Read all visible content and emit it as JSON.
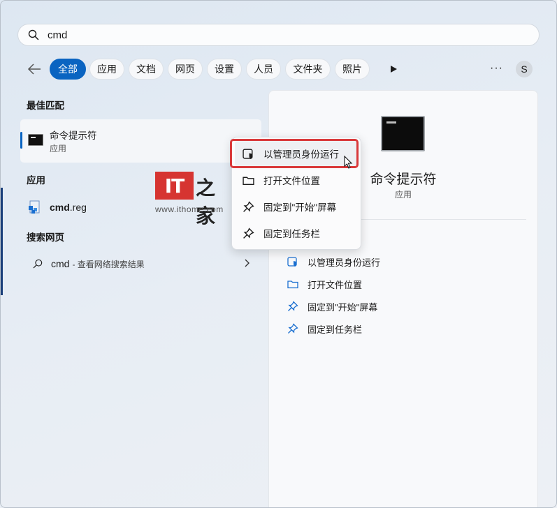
{
  "search": {
    "query": "cmd"
  },
  "filters": {
    "chips": [
      "全部",
      "应用",
      "文档",
      "网页",
      "设置",
      "人员",
      "文件夹",
      "照片"
    ],
    "more": "···",
    "avatar": "S"
  },
  "left": {
    "best_match_title": "最佳匹配",
    "best_match": {
      "name": "命令提示符",
      "type": "应用"
    },
    "apps_title": "应用",
    "apps": [
      {
        "name_bold": "cmd",
        "name_rest": ".reg"
      }
    ],
    "web_title": "搜索网页",
    "web": {
      "query": "cmd",
      "hint": "- 查看网络搜索结果"
    }
  },
  "watermark": {
    "logo": "IT",
    "brand": "之家",
    "url": "www.ithome.com"
  },
  "context_menu": {
    "items": [
      "以管理员身份运行",
      "打开文件位置",
      "固定到\"开始\"屏幕",
      "固定到任务栏"
    ]
  },
  "panel": {
    "title": "命令提示符",
    "subtitle": "应用",
    "actions": [
      "以管理员身份运行",
      "打开文件位置",
      "固定到\"开始\"屏幕",
      "固定到任务栏"
    ]
  },
  "colors": {
    "accent": "#0a64c1",
    "highlight": "#d9393a",
    "icon_blue": "#1a6fd0"
  }
}
